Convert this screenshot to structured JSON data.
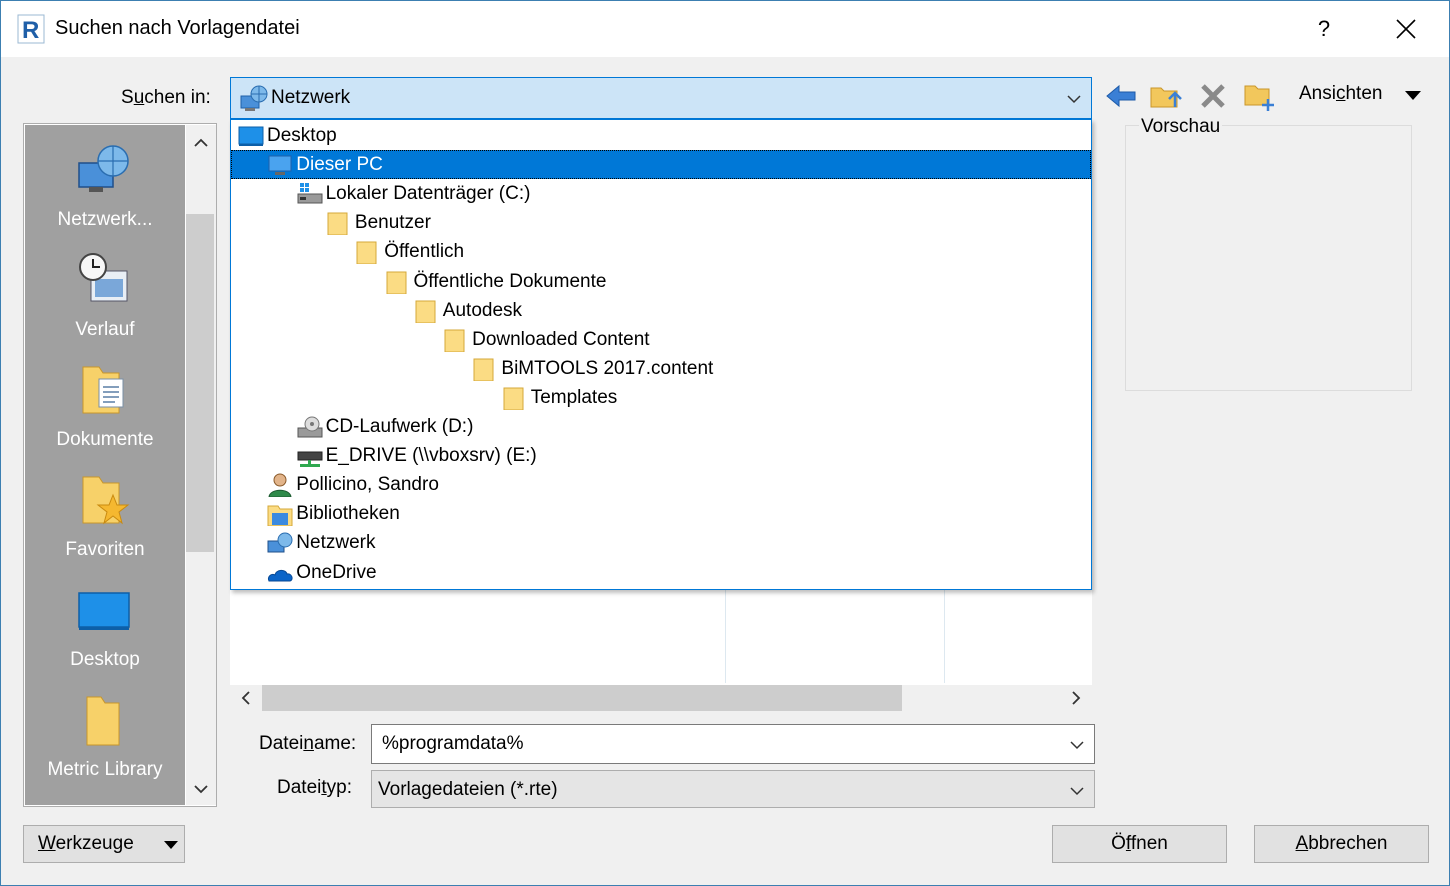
{
  "window": {
    "title": "Suchen nach Vorlagendatei",
    "help_label": "?"
  },
  "lookin": {
    "label_pre": "S",
    "label_u": "u",
    "label_post": "chen in:",
    "value": "Netzwerk"
  },
  "toolbar": {
    "views_pre": "Ansi",
    "views_u": "c",
    "views_post": "hten"
  },
  "places": [
    {
      "label": "Netzwerk...",
      "icon": "network-icon"
    },
    {
      "label": "Verlauf",
      "icon": "history-icon"
    },
    {
      "label": "Dokumente",
      "icon": "documents-folder-icon"
    },
    {
      "label": "Favoriten",
      "icon": "favorites-folder-icon"
    },
    {
      "label": "Desktop",
      "icon": "desktop-icon"
    },
    {
      "label": "Metric Library",
      "icon": "folder-icon"
    }
  ],
  "dropdown": [
    {
      "label": "Desktop",
      "icon": "desktop-icon",
      "indent": 0,
      "selected": false
    },
    {
      "label": "Dieser PC",
      "icon": "computer-icon",
      "indent": 1,
      "selected": true
    },
    {
      "label": "Lokaler Datenträger (C:)",
      "icon": "hard-drive-icon",
      "indent": 2,
      "selected": false
    },
    {
      "label": "Benutzer",
      "icon": "folder-icon",
      "indent": 3,
      "selected": false
    },
    {
      "label": "Öffentlich",
      "icon": "folder-icon",
      "indent": 4,
      "selected": false
    },
    {
      "label": "Öffentliche Dokumente",
      "icon": "folder-icon",
      "indent": 5,
      "selected": false
    },
    {
      "label": "Autodesk",
      "icon": "folder-icon",
      "indent": 6,
      "selected": false
    },
    {
      "label": "Downloaded Content",
      "icon": "folder-icon",
      "indent": 7,
      "selected": false
    },
    {
      "label": "BiMTOOLS 2017.content",
      "icon": "folder-icon",
      "indent": 8,
      "selected": false
    },
    {
      "label": "Templates",
      "icon": "folder-icon",
      "indent": 9,
      "selected": false
    },
    {
      "label": "CD-Laufwerk (D:)",
      "icon": "cd-drive-icon",
      "indent": 2,
      "selected": false
    },
    {
      "label": "E_DRIVE (\\\\vboxsrv) (E:)",
      "icon": "network-drive-icon",
      "indent": 2,
      "selected": false
    },
    {
      "label": "Pollicino, Sandro",
      "icon": "user-icon",
      "indent": 1,
      "selected": false
    },
    {
      "label": "Bibliotheken",
      "icon": "libraries-icon",
      "indent": 1,
      "selected": false
    },
    {
      "label": "Netzwerk",
      "icon": "network-icon",
      "indent": 1,
      "selected": false
    },
    {
      "label": "OneDrive",
      "icon": "onedrive-icon",
      "indent": 1,
      "selected": false
    }
  ],
  "preview": {
    "label": "Vorschau"
  },
  "filename": {
    "label_pre": "Datei",
    "label_u": "n",
    "label_post": "ame:",
    "value": "%programdata%"
  },
  "filetype": {
    "label_pre": "Datei",
    "label_u": "t",
    "label_post": "yp:",
    "value": "Vorlagedateien  (*.rte)"
  },
  "buttons": {
    "tools_u": "W",
    "tools_post": "erkzeuge",
    "open_pre": "Ö",
    "open_u": "f",
    "open_post": "fnen",
    "cancel_u": "A",
    "cancel_post": "bbrechen"
  },
  "colors": {
    "accent": "#0078d7",
    "combo_highlight": "#cce4f7",
    "places_bg": "#a0a0a0",
    "folder_yellow": "#ffd966"
  }
}
